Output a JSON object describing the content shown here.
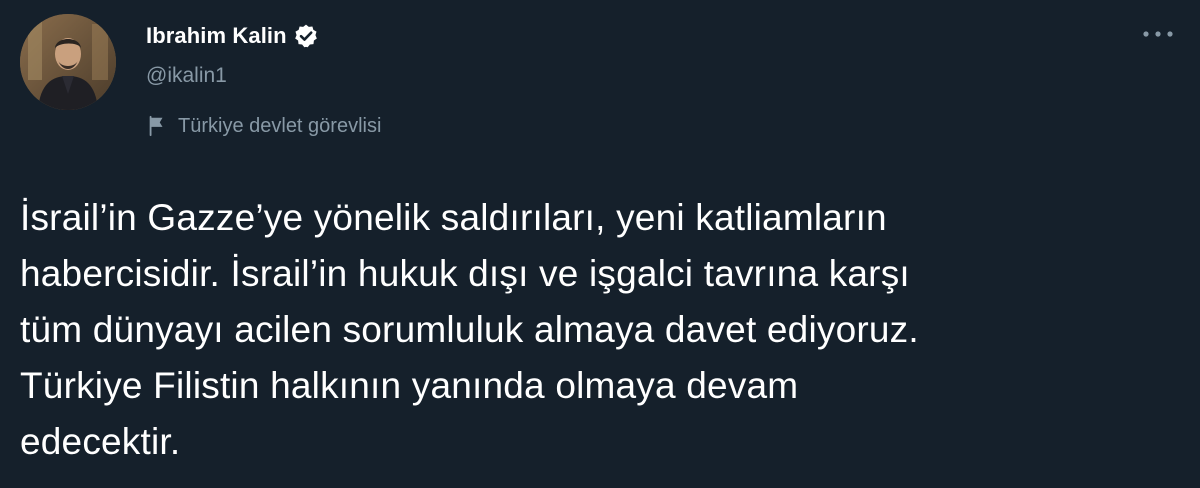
{
  "author": {
    "display_name": "Ibrahim Kalin",
    "handle": "@ikalin1",
    "verified_icon": "verified-badge-icon",
    "label": "Türkiye devlet görevlisi",
    "label_icon": "flag-icon"
  },
  "menu": {
    "icon": "more-horizontal-icon"
  },
  "tweet": {
    "text": "İsrail’in Gazze’ye yönelik saldırıları, yeni katliamların\nhabercisidir. İsrail’in hukuk dışı ve işgalci tavrına karşı\ntüm dünyayı acilen sorumluluk almaya davet ediyoruz.\nTürkiye Filistin halkının yanında olmaya devam\nedecektir."
  },
  "colors": {
    "background": "#15202b",
    "primary_text": "#ffffff",
    "secondary_text": "#8899a6"
  }
}
